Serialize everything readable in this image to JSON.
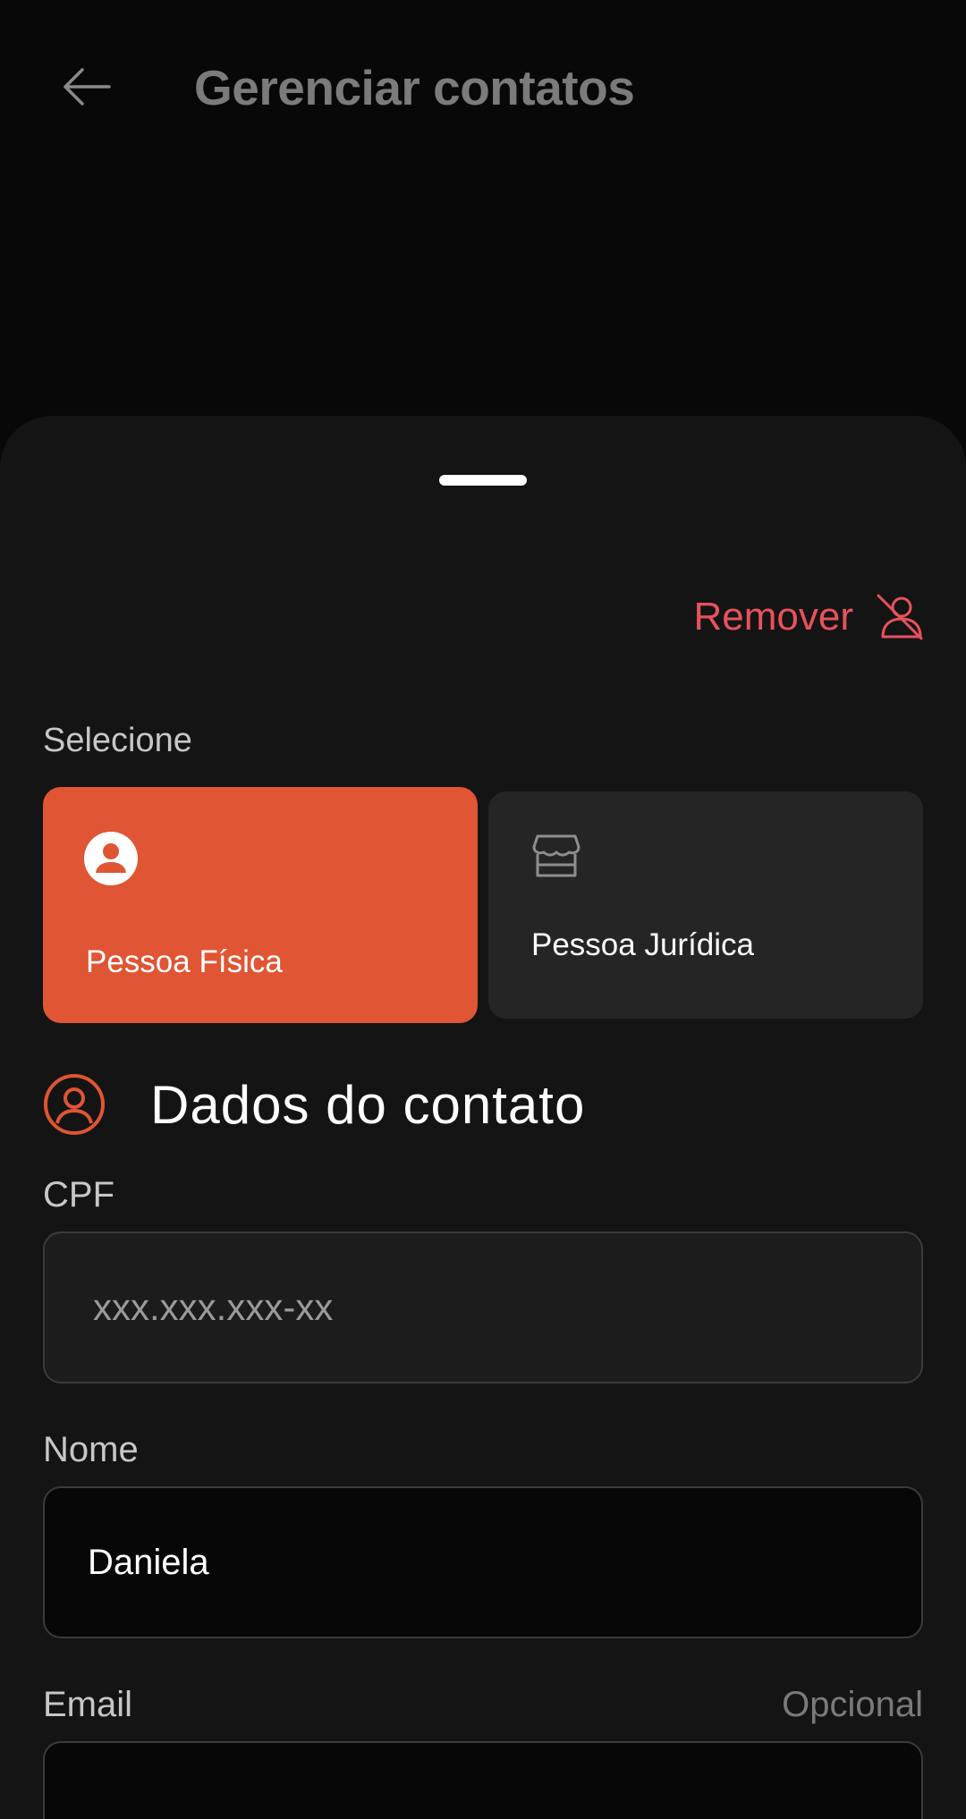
{
  "header": {
    "title": "Gerenciar contatos",
    "back_icon": "arrow-left-icon"
  },
  "sheet": {
    "remove": {
      "label": "Remover",
      "icon": "user-remove-icon",
      "color": "#e8525c"
    },
    "select_label": "Selecione",
    "person_types": [
      {
        "label": "Pessoa Física",
        "icon": "user-circle-icon",
        "selected": true,
        "color": "#e05533"
      },
      {
        "label": "Pessoa Jurídica",
        "icon": "storefront-icon",
        "selected": false,
        "color": "#252525"
      }
    ],
    "section_title": "Dados do contato",
    "section_icon": "user-circle-outline-icon",
    "fields": {
      "cpf": {
        "label": "CPF",
        "placeholder": "xxx.xxx.xxx-xx",
        "value": ""
      },
      "nome": {
        "label": "Nome",
        "value": "Daniela"
      },
      "email": {
        "label": "Email",
        "optional_label": "Opcional",
        "value": ""
      }
    }
  }
}
